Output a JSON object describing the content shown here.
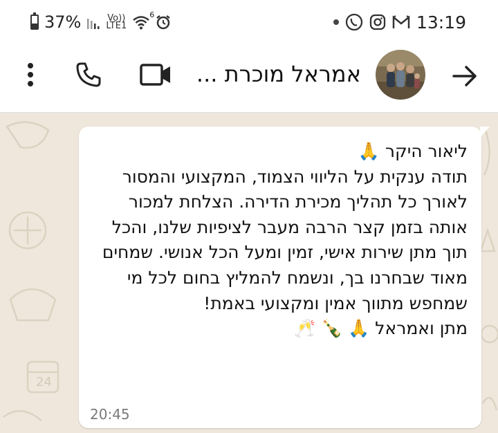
{
  "status_bar": {
    "battery": "37%",
    "battery_level": 0.37,
    "network_top": "Vo))",
    "network_bottom": "LTE1",
    "wifi_badge": "6",
    "time": "13:19"
  },
  "header": {
    "contact_name": "אמראל מוכרת ..."
  },
  "message": {
    "text": "ליאור היקר 🙏\nתודה ענקית על הליווי הצמוד, המקצועי והמסור לאורך כל תהליך מכירת הדירה. הצלחת למכור אותה בזמן קצר הרבה מעבר לציפיות שלנו, והכל תוך מתן שירות אישי, זמין ומעל הכל אנושי. שמחים מאוד שבחרנו בך, ונשמח להמליץ בחום לכל מי שמחפש מתווך אמין ומקצועי באמת!\nמתן ואמראל 🙏 🍾 🥂",
    "time": "20:45"
  },
  "colors": {
    "chat_bg": "#efe7dc",
    "bubble": "#ffffff",
    "header": "#ffffff"
  },
  "icons": [
    "battery-icon",
    "signal-icon",
    "wifi-icon",
    "alarm-icon",
    "whatsapp-icon",
    "instagram-icon",
    "gmail-icon",
    "more-vert-icon",
    "phone-icon",
    "video-icon",
    "back-arrow-icon"
  ]
}
